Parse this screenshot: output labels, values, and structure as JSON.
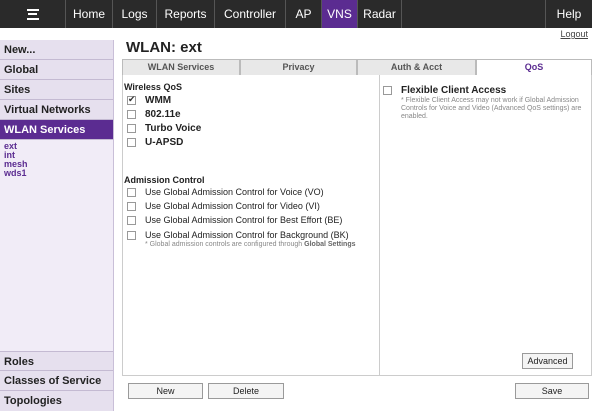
{
  "topnav": {
    "items": [
      "Home",
      "Logs",
      "Reports",
      "Controller",
      "AP",
      "VNS",
      "Radar"
    ],
    "active": "VNS",
    "help": "Help"
  },
  "logout": "Logout",
  "sidebar": {
    "new": "New...",
    "global": "Global",
    "sites": "Sites",
    "virtual_networks": "Virtual Networks",
    "wlan_services": "WLAN Services",
    "wlans": [
      "ext",
      "int",
      "mesh",
      "wds1"
    ],
    "roles": "Roles",
    "classes_of_service": "Classes of Service",
    "topologies": "Topologies"
  },
  "page_title": "WLAN: ext",
  "tabs": [
    "WLAN Services",
    "Privacy",
    "Auth & Acct",
    "QoS"
  ],
  "active_tab": "QoS",
  "wireless_qos": {
    "label": "Wireless QoS",
    "options": [
      {
        "label": "WMM",
        "checked": true
      },
      {
        "label": "802.11e",
        "checked": false
      },
      {
        "label": "Turbo Voice",
        "checked": false
      },
      {
        "label": "U-APSD",
        "checked": false
      }
    ]
  },
  "admission_control": {
    "label": "Admission Control",
    "options": [
      {
        "label": "Use Global Admission Control for Voice (VO)",
        "checked": false
      },
      {
        "label": "Use Global Admission Control for Video (VI)",
        "checked": false
      },
      {
        "label": "Use Global Admission Control for Best Effort (BE)",
        "checked": false
      },
      {
        "label": "Use Global Admission Control for Background (BK)",
        "checked": false
      }
    ],
    "note_prefix": "* Global admission controls are configured through",
    "note_link": "Global Settings"
  },
  "flexible_client_access": {
    "label": "Flexible Client Access",
    "checked": false,
    "note": "* Flexible Client Access may not work if Global Admission Controls for Voice and Video (Advanced QoS settings) are enabled."
  },
  "buttons": {
    "advanced": "Advanced",
    "new": "New",
    "delete": "Delete",
    "save": "Save"
  },
  "colors": {
    "accent": "#5b2c91",
    "topbar": "#2a2a2a",
    "sidebar_bg": "#f1ecf7"
  }
}
